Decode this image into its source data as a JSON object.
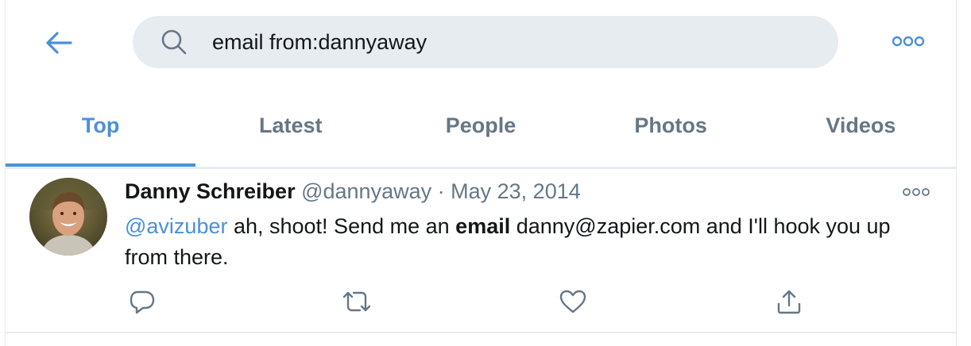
{
  "search": {
    "query": "email from:dannyaway"
  },
  "tabs": [
    {
      "label": "Top",
      "active": true
    },
    {
      "label": "Latest",
      "active": false
    },
    {
      "label": "People",
      "active": false
    },
    {
      "label": "Photos",
      "active": false
    },
    {
      "label": "Videos",
      "active": false
    }
  ],
  "tweet": {
    "name": "Danny Schreiber",
    "handle": "@dannyaway",
    "separator": "·",
    "date": "May 23, 2014",
    "mention": "@avizuber",
    "text_before_bold": " ah, shoot! Send me an ",
    "bold_word": "email",
    "text_after_bold": " danny@zapier.com and I'll hook you up from there."
  },
  "icons": {
    "back": "arrow-left-icon",
    "search": "search-icon",
    "more": "more-horizontal-icon",
    "reply": "reply-icon",
    "retweet": "retweet-icon",
    "like": "heart-icon",
    "share": "share-icon"
  },
  "colors": {
    "accent": "#4a90d9",
    "secondary_text": "#657786",
    "search_bg": "#e6ecf0",
    "text": "#14171a"
  }
}
